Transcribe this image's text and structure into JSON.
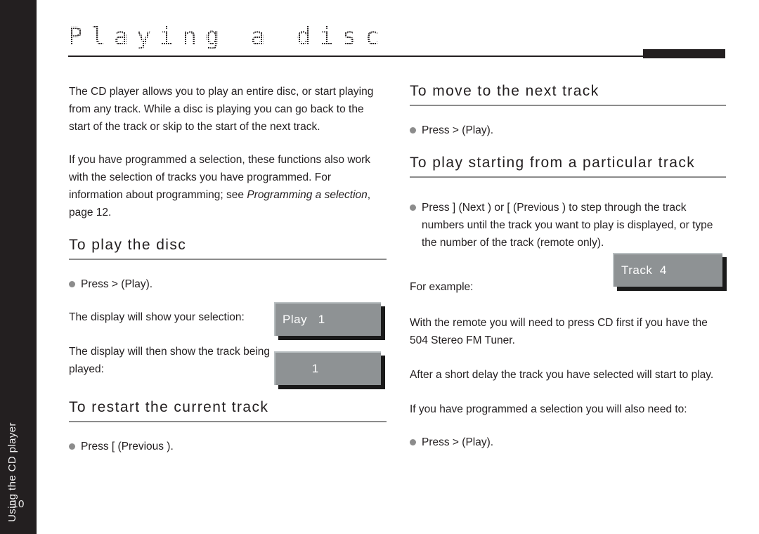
{
  "sidebar": {
    "section_label": "Using the CD player",
    "page_number": "10"
  },
  "header": {
    "title": "Playing a disc"
  },
  "left_column": {
    "intro_paragraph_1": "The CD player allows you to play an entire disc, or start playing from any track. While a disc is playing you can go back to the start of the track or skip to the start of the next track.",
    "intro_paragraph_2_a": "If you have programmed a selection, these functions also work with the selection of tracks you have programmed. For information about programming; see ",
    "intro_paragraph_2_italic": "Programming a selection",
    "intro_paragraph_2_b": ", page 12.",
    "heading_play_disc": "To play the disc",
    "bullet_press_play": "Press >  (Play).",
    "caption_show_selection": "The display will show your selection:",
    "caption_show_track": "The display will then show the track being played:",
    "heading_restart_track": "To restart the current track",
    "bullet_press_previous": "Press [    (Previous )."
  },
  "right_column": {
    "heading_next_track": "To move to the next track",
    "bullet_press_play": "Press >  (Play).",
    "heading_particular_track": "To play starting from a particular track",
    "bullet_press_next_previous": "Press ]   (Next )  or [    (Previous )  to step through the track numbers until the track you want to play is displayed, or type the number of the track (remote only).",
    "caption_for_example": "For example:",
    "paragraph_remote": "With the remote you will need to press  CD first if you have the 504 Stereo FM Tuner.",
    "paragraph_delay": "After a short delay the track you have selected will start to play.",
    "paragraph_programmed": "If you have programmed a selection you will also need to:",
    "bullet_press_play_2": "Press >  (Play)."
  },
  "displays": {
    "play_selection": "Play   1",
    "track_number": "        1",
    "track_four": "Track  4"
  },
  "colors": {
    "sidebar_background": "#231f20",
    "text": "#231f20",
    "rule": "#8c8c8c",
    "lcd_background": "#8e9294",
    "lcd_text": "#ffffff",
    "bullet": "#8c8c8c"
  }
}
